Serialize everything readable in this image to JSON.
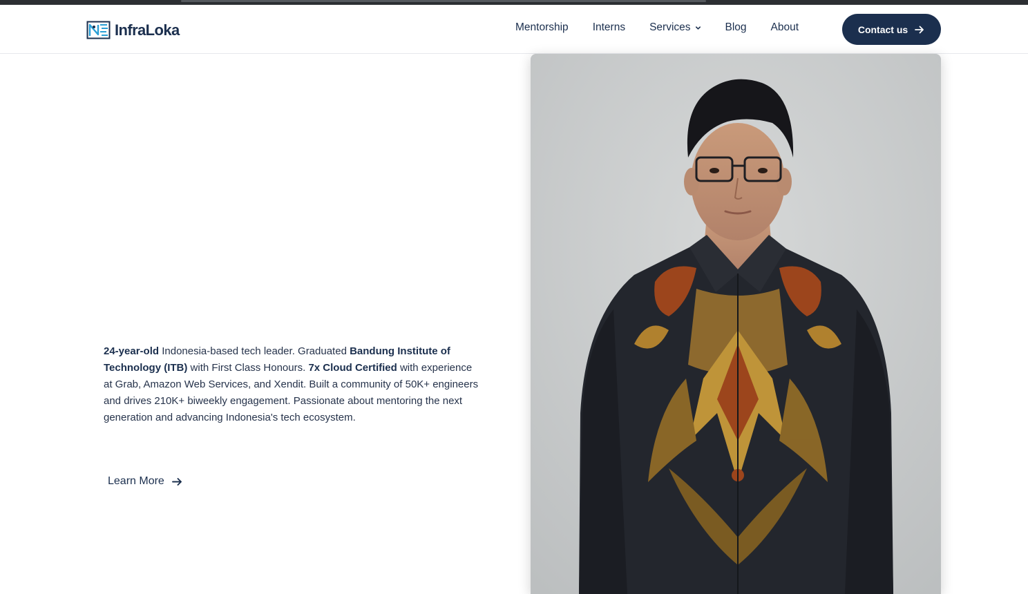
{
  "brand": {
    "name": "InfraLoka",
    "logo_icon": "infraloka-logo-icon"
  },
  "nav": {
    "items": [
      {
        "label": "Mentorship"
      },
      {
        "label": "Interns"
      },
      {
        "label": "Services",
        "icon": "chevron-down-icon"
      },
      {
        "label": "Blog"
      },
      {
        "label": "About"
      }
    ],
    "contact_label": "Contact us",
    "contact_icon": "arrow-right-icon"
  },
  "hero": {
    "bio": {
      "b1": "24-year-old",
      "t1": " Indonesia-based tech leader. Graduated ",
      "b2": "Bandung Institute of Technology (ITB)",
      "t2": " with First Class Honours. ",
      "b3": "7x Cloud Certified",
      "t3": " with experience at Grab, Amazon Web Services, and Xendit. Built a community of 50K+ engineers and drives 210K+ biweekly engagement. Passionate about mentoring the next generation and advancing Indonesia's tech ecosystem."
    },
    "learn_more_label": "Learn More",
    "learn_more_icon": "arrow-right-icon",
    "photo_icon": "portrait-photo"
  },
  "colors": {
    "brand_navy": "#1b2f4e",
    "logo_cyan": "#2a9fd6",
    "photo_backdrop": "#c9cbcc",
    "shirt_dark": "#23262d",
    "batik_gold": "#b8862f",
    "batik_rust": "#a3471c"
  }
}
